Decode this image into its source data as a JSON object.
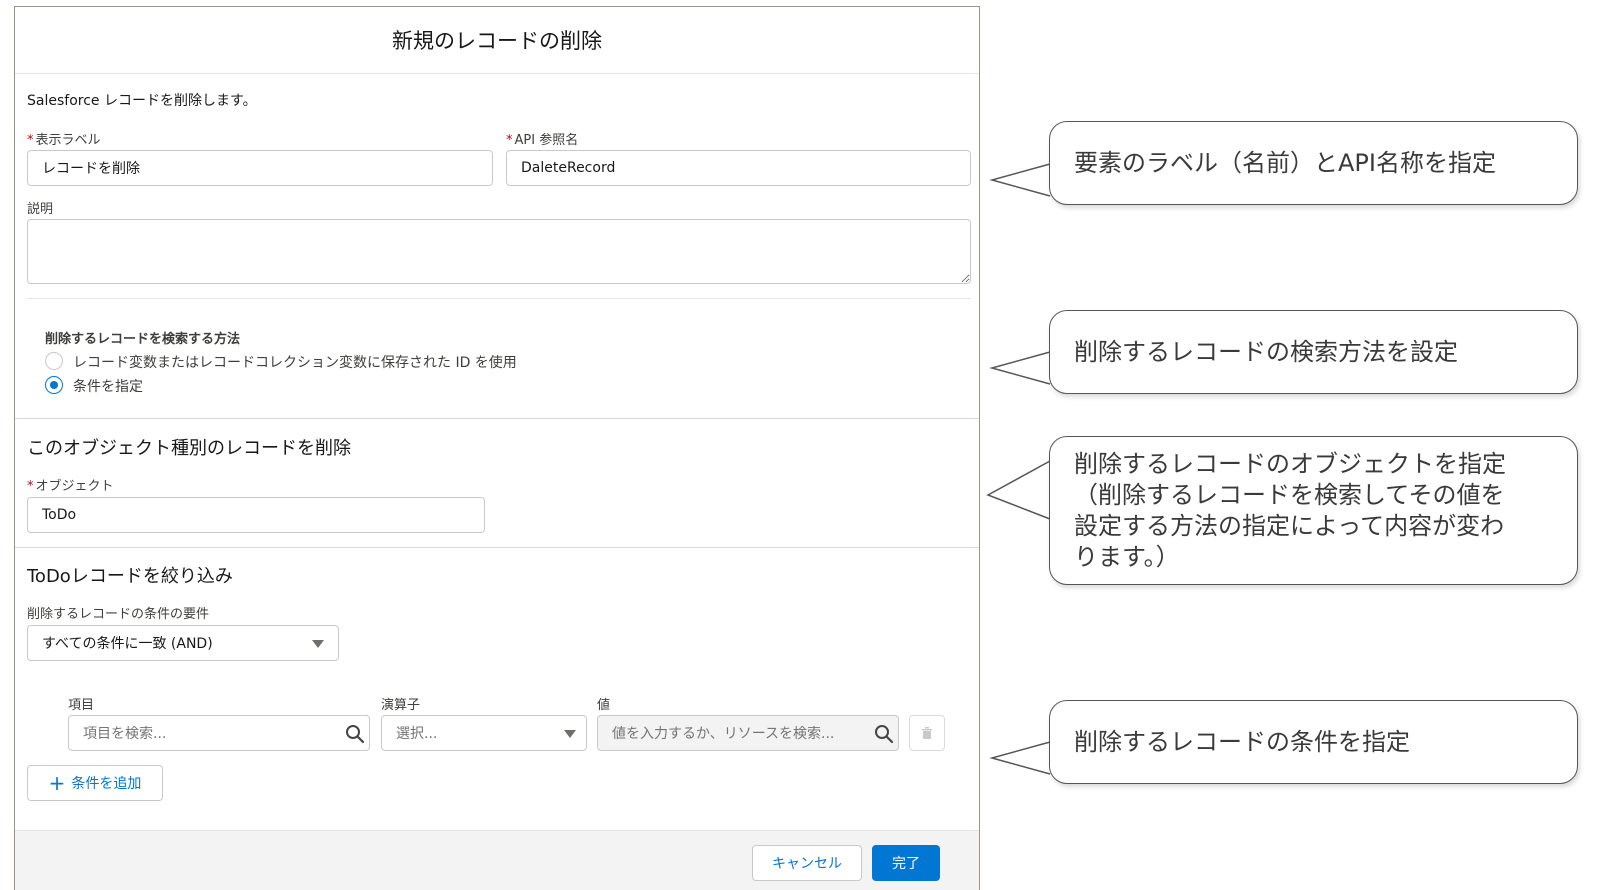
{
  "modal": {
    "title": "新規のレコードの削除",
    "description": "Salesforce レコードを削除します。",
    "label_field": {
      "label": "表示ラベル",
      "value": "レコードを削除"
    },
    "api_field": {
      "label": "API 参照名",
      "value": "DaleteRecord"
    },
    "description_field": {
      "label": "説明",
      "value": ""
    },
    "search_method": {
      "heading": "削除するレコードを検索する方法",
      "options": [
        {
          "label": "レコード変数またはレコードコレクション変数に保存された ID を使用",
          "checked": false
        },
        {
          "label": "条件を指定",
          "checked": true
        }
      ]
    },
    "object_section": {
      "title": "このオブジェクト種別のレコードを削除",
      "object_label": "オブジェクト",
      "object_value": "ToDo"
    },
    "filter_section": {
      "title": "ToDoレコードを絞り込み",
      "requirement_label": "削除するレコードの条件の要件",
      "requirement_value": "すべての条件に一致 (AND)",
      "columns": {
        "field": "項目",
        "operator": "演算子",
        "value": "値"
      },
      "field_placeholder": "項目を検索...",
      "operator_placeholder": "選択...",
      "value_placeholder": "値を入力するか、リソースを検索...",
      "add_condition": "条件を追加"
    },
    "footer": {
      "cancel": "キャンセル",
      "done": "完了"
    }
  },
  "callouts": [
    {
      "lines": [
        "要素のラベル（名前）とAPI名称を指定"
      ]
    },
    {
      "lines": [
        "削除するレコードの検索方法を設定"
      ]
    },
    {
      "lines": [
        "削除するレコードのオブジェクトを指定",
        "（削除するレコードを検索してその値を",
        "設定する方法の指定によって内容が変わ",
        "ります。）"
      ]
    },
    {
      "lines": [
        "削除するレコードの条件を指定"
      ]
    }
  ],
  "colors": {
    "brand": "#0176d3",
    "required": "#ba0517",
    "border": "#c9c9c9"
  },
  "icons": [
    "search-icon",
    "dropdown-triangle-icon",
    "delete-icon",
    "plus-icon"
  ]
}
